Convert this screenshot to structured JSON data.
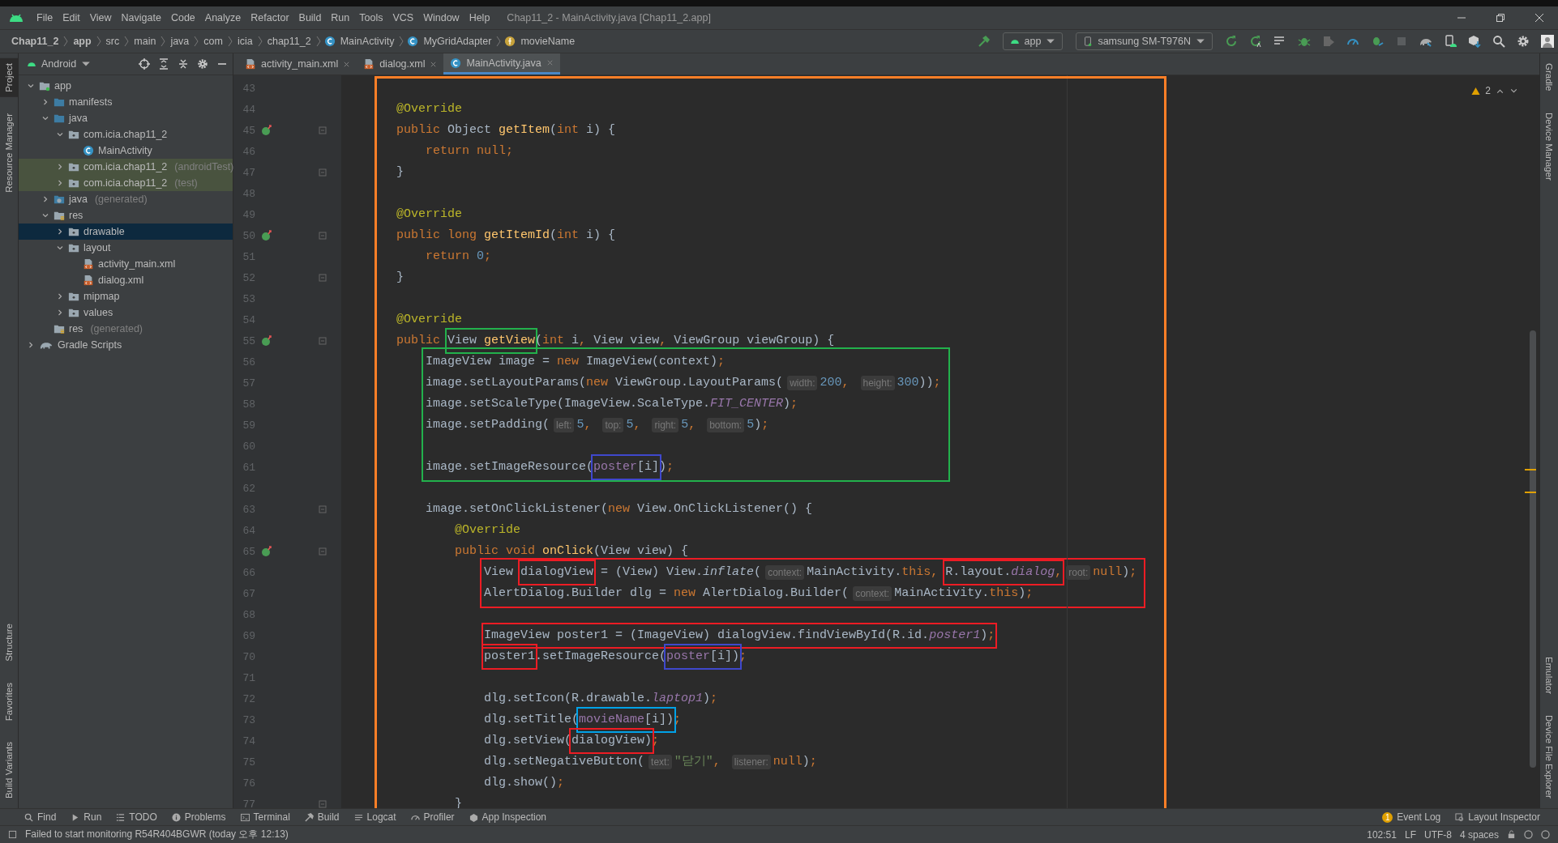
{
  "window": {
    "title": "Chap11_2 - MainActivity.java [Chap11_2.app]"
  },
  "menu": [
    "File",
    "Edit",
    "View",
    "Navigate",
    "Code",
    "Analyze",
    "Refactor",
    "Build",
    "Run",
    "Tools",
    "VCS",
    "Window",
    "Help"
  ],
  "breadcrumbs": [
    {
      "label": "Chap11_2",
      "kind": "plain"
    },
    {
      "label": "app",
      "kind": "plain"
    },
    {
      "label": "src",
      "kind": "plain"
    },
    {
      "label": "main",
      "kind": "plain"
    },
    {
      "label": "java",
      "kind": "plain"
    },
    {
      "label": "com",
      "kind": "plain"
    },
    {
      "label": "icia",
      "kind": "plain"
    },
    {
      "label": "chap11_2",
      "kind": "plain"
    },
    {
      "label": "MainActivity",
      "kind": "class"
    },
    {
      "label": "MyGridAdapter",
      "kind": "class"
    },
    {
      "label": "movieName",
      "kind": "field"
    }
  ],
  "run_config": "app",
  "device": "samsung SM-T976N",
  "project": {
    "view": "Android",
    "tree": [
      {
        "label": "app",
        "kind": "module",
        "expanded": true,
        "selected": false,
        "tinted": false,
        "children": [
          {
            "label": "manifests",
            "kind": "source",
            "expanded": false,
            "selected": false,
            "tinted": false
          },
          {
            "label": "java",
            "kind": "source",
            "expanded": true,
            "selected": false,
            "tinted": false,
            "children": [
              {
                "label": "com.icia.chap11_2",
                "kind": "package",
                "expanded": true,
                "selected": false,
                "tinted": false,
                "children": [
                  {
                    "label": "MainActivity",
                    "kind": "class",
                    "selected": false,
                    "tinted": false
                  }
                ]
              },
              {
                "label": "com.icia.chap11_2",
                "suffix": "(androidTest)",
                "kind": "package",
                "expanded": false,
                "selected": false,
                "tinted": true
              },
              {
                "label": "com.icia.chap11_2",
                "suffix": "(test)",
                "kind": "package",
                "expanded": false,
                "selected": false,
                "tinted": true
              }
            ]
          },
          {
            "label": "java",
            "suffix": "(generated)",
            "kind": "generated",
            "expanded": false,
            "selected": false,
            "tinted": false
          },
          {
            "label": "res",
            "kind": "res",
            "expanded": true,
            "selected": false,
            "tinted": false,
            "children": [
              {
                "label": "drawable",
                "kind": "package",
                "expanded": false,
                "selected": true,
                "tinted": false
              },
              {
                "label": "layout",
                "kind": "package",
                "expanded": true,
                "selected": false,
                "tinted": false,
                "children": [
                  {
                    "label": "activity_main.xml",
                    "kind": "xml",
                    "selected": false,
                    "tinted": false
                  },
                  {
                    "label": "dialog.xml",
                    "kind": "xml",
                    "selected": false,
                    "tinted": false
                  }
                ]
              },
              {
                "label": "mipmap",
                "kind": "package",
                "expanded": false,
                "selected": false,
                "tinted": false
              },
              {
                "label": "values",
                "kind": "package",
                "expanded": false,
                "selected": false,
                "tinted": false
              }
            ]
          },
          {
            "label": "res",
            "suffix": "(generated)",
            "kind": "res",
            "selected": false,
            "tinted": false
          }
        ]
      },
      {
        "label": "Gradle Scripts",
        "kind": "gradle",
        "expanded": false,
        "selected": false,
        "tinted": false
      }
    ]
  },
  "tabs": [
    {
      "label": "activity_main.xml",
      "kind": "xml",
      "selected": false
    },
    {
      "label": "dialog.xml",
      "kind": "xml",
      "selected": false
    },
    {
      "label": "MainActivity.java",
      "kind": "class",
      "selected": true
    }
  ],
  "left_stripe": {
    "top": [
      {
        "label": "Project",
        "selected": true
      },
      {
        "label": "Resource Manager",
        "selected": false
      }
    ],
    "bottom": [
      {
        "label": "Structure",
        "selected": false
      },
      {
        "label": "Favorites",
        "selected": false
      },
      {
        "label": "Build Variants",
        "selected": false
      }
    ]
  },
  "right_stripe": {
    "top": [
      "Gradle",
      "Device Manager"
    ],
    "bottom": [
      "Emulator",
      "Device File Explorer"
    ]
  },
  "editor": {
    "warnings": "2",
    "frame": {
      "color": "#ff7f27"
    },
    "blocks": [
      {
        "lines": [
          {
            "n": "43"
          },
          {
            "n": "44",
            "tokens": [
              {
                "t": "@Override",
                "kind": "annotation"
              }
            ]
          },
          {
            "n": "45",
            "overrides": true,
            "fold": true,
            "tokens": [
              {
                "t": "public ",
                "kind": "keyword"
              },
              {
                "t": "Object ",
                "kind": "plain"
              },
              {
                "t": "getItem",
                "kind": "method"
              },
              {
                "t": "(",
                "kind": "plain"
              },
              {
                "t": "int",
                "kind": "keyword"
              },
              {
                "t": " i) {",
                "kind": "plain"
              }
            ]
          },
          {
            "n": "46",
            "tokens": [
              {
                "t": "return null",
                "kind": "keyword"
              },
              {
                "t": ";",
                "kind": "keyword"
              }
            ]
          },
          {
            "n": "47",
            "fold": true,
            "tokens": [
              {
                "t": "}",
                "kind": "plain"
              }
            ]
          },
          {
            "n": "48"
          },
          {
            "n": "49",
            "tokens": [
              {
                "t": "@Override",
                "kind": "annotation"
              }
            ]
          },
          {
            "n": "50",
            "overrides": true,
            "fold": true,
            "tokens": [
              {
                "t": "public long ",
                "kind": "keyword"
              },
              {
                "t": "getItemId",
                "kind": "method"
              },
              {
                "t": "(",
                "kind": "plain"
              },
              {
                "t": "int",
                "kind": "keyword"
              },
              {
                "t": " i) {",
                "kind": "plain"
              }
            ]
          },
          {
            "n": "51",
            "tokens": [
              {
                "t": "return ",
                "kind": "keyword"
              },
              {
                "t": "0",
                "kind": "number"
              },
              {
                "t": ";",
                "kind": "keyword"
              }
            ]
          },
          {
            "n": "52",
            "fold": true,
            "tokens": [
              {
                "t": "}",
                "kind": "plain"
              }
            ]
          },
          {
            "n": "53"
          },
          {
            "n": "54",
            "tokens": [
              {
                "t": "@Override",
                "kind": "annotation"
              }
            ]
          },
          {
            "n": "55",
            "overrides": true,
            "fold": true,
            "tokens": [
              {
                "t": "public ",
                "kind": "keyword"
              },
              {
                "color": "#22b14c",
                "tokens": [
                  {
                    "t": "View ",
                    "kind": "plain"
                  },
                  {
                    "t": "getView",
                    "kind": "method"
                  }
                ]
              },
              {
                "t": "(",
                "kind": "plain"
              },
              {
                "t": "int ",
                "kind": "keyword"
              },
              {
                "t": "i",
                "kind": "plain"
              },
              {
                "t": ",",
                "kind": "keyword"
              },
              {
                "t": " View view",
                "kind": "plain"
              },
              {
                "t": ",",
                "kind": "keyword"
              },
              {
                "t": " ViewGroup viewGroup) {",
                "kind": "plain"
              }
            ]
          }
        ]
      },
      {
        "color": "#22b14c",
        "lines": [
          {
            "n": "56",
            "tokens": [
              {
                "t": "ImageView image = ",
                "kind": "plain"
              },
              {
                "t": "new ",
                "kind": "keyword"
              },
              {
                "t": "ImageView(context)",
                "kind": "plain"
              },
              {
                "t": ";",
                "kind": "keyword"
              }
            ]
          },
          {
            "n": "57",
            "tokens": [
              {
                "t": "image.setLayoutParams(",
                "kind": "plain"
              },
              {
                "t": "new ",
                "kind": "keyword"
              },
              {
                "t": "ViewGroup.LayoutParams(",
                "kind": "plain"
              },
              {
                "t": "width:",
                "kind": "hint"
              },
              {
                "t": "200",
                "kind": "number"
              },
              {
                "t": ", ",
                "kind": "keyword"
              },
              {
                "t": "height:",
                "kind": "hint"
              },
              {
                "t": "300",
                "kind": "number"
              },
              {
                "t": "))",
                "kind": "plain"
              },
              {
                "t": ";",
                "kind": "keyword"
              }
            ]
          },
          {
            "n": "58",
            "tokens": [
              {
                "t": "image.setScaleType(ImageView.ScaleType.",
                "kind": "plain"
              },
              {
                "t": "FIT_CENTER",
                "kind": "constant"
              },
              {
                "t": ")",
                "kind": "plain"
              },
              {
                "t": ";",
                "kind": "keyword"
              }
            ]
          },
          {
            "n": "59",
            "tokens": [
              {
                "t": "image.setPadding(",
                "kind": "plain"
              },
              {
                "t": "left:",
                "kind": "hint"
              },
              {
                "t": "5",
                "kind": "number"
              },
              {
                "t": ", ",
                "kind": "keyword"
              },
              {
                "t": "top:",
                "kind": "hint"
              },
              {
                "t": "5",
                "kind": "number"
              },
              {
                "t": ", ",
                "kind": "keyword"
              },
              {
                "t": "right:",
                "kind": "hint"
              },
              {
                "t": "5",
                "kind": "number"
              },
              {
                "t": ", ",
                "kind": "keyword"
              },
              {
                "t": "bottom:",
                "kind": "hint"
              },
              {
                "t": "5",
                "kind": "number"
              },
              {
                "t": ")",
                "kind": "plain"
              },
              {
                "t": ";",
                "kind": "keyword"
              }
            ]
          },
          {
            "n": "60"
          },
          {
            "n": "61",
            "tokens": [
              {
                "t": "image.setImageResource(",
                "kind": "plain"
              },
              {
                "color": "#3f48cc",
                "tokens": [
                  {
                    "t": "poster",
                    "kind": "field"
                  },
                  {
                    "t": "[i]",
                    "kind": "plain"
                  }
                ]
              },
              {
                "t": ")",
                "kind": "plain"
              },
              {
                "t": ";",
                "kind": "keyword"
              }
            ]
          }
        ]
      },
      {
        "lines": [
          {
            "n": "62"
          },
          {
            "n": "63",
            "fold": true,
            "tokens": [
              {
                "t": "image.setOnClickListener(",
                "kind": "plain"
              },
              {
                "t": "new ",
                "kind": "keyword"
              },
              {
                "t": "View.OnClickListener() {",
                "kind": "plain"
              }
            ]
          },
          {
            "n": "64",
            "tokens": [
              {
                "t": "@Override",
                "kind": "annotation"
              }
            ]
          },
          {
            "n": "65",
            "overrides": true,
            "fold": true,
            "tokens": [
              {
                "t": "public void ",
                "kind": "keyword"
              },
              {
                "t": "onClick",
                "kind": "method"
              },
              {
                "t": "(View view) {",
                "kind": "plain"
              }
            ]
          }
        ]
      },
      {
        "color": "#ed1c24",
        "lines": [
          {
            "n": "66",
            "tokens": [
              {
                "t": "View ",
                "kind": "plain"
              },
              {
                "color": "#ed1c24",
                "tokens": [
                  {
                    "t": "dialogView",
                    "kind": "plain"
                  }
                ]
              },
              {
                "t": " = (View) View.",
                "kind": "plain"
              },
              {
                "t": "inflate",
                "kind": "italic"
              },
              {
                "t": "(",
                "kind": "plain"
              },
              {
                "t": "context:",
                "kind": "hint"
              },
              {
                "t": "MainActivity.",
                "kind": "plain"
              },
              {
                "t": "this",
                "kind": "keyword"
              },
              {
                "t": ", ",
                "kind": "keyword"
              },
              {
                "color": "#ed1c24",
                "tokens": [
                  {
                    "t": "R.layout.",
                    "kind": "plain"
                  },
                  {
                    "t": "dialog",
                    "kind": "constant"
                  },
                  {
                    "t": ",",
                    "kind": "keyword"
                  }
                ]
              },
              {
                "t": "root:",
                "kind": "hint"
              },
              {
                "t": "null",
                "kind": "keyword"
              },
              {
                "t": ")",
                "kind": "plain"
              },
              {
                "t": ";",
                "kind": "keyword"
              }
            ]
          },
          {
            "n": "67",
            "tokens": [
              {
                "t": "AlertDialog.Builder dlg = ",
                "kind": "plain"
              },
              {
                "t": "new ",
                "kind": "keyword"
              },
              {
                "t": "AlertDialog.Builder(",
                "kind": "plain"
              },
              {
                "t": "context:",
                "kind": "hint"
              },
              {
                "t": "MainActivity.",
                "kind": "plain"
              },
              {
                "t": "this",
                "kind": "keyword"
              },
              {
                "t": ")",
                "kind": "plain"
              },
              {
                "t": ";",
                "kind": "keyword"
              }
            ]
          }
        ]
      },
      {
        "lines": [
          {
            "n": "68"
          },
          {
            "n": "69",
            "tokens": [
              {
                "color": "#ed1c24",
                "tokens": [
                  {
                    "t": "ImageView poster1 = (ImageView) dialogView.findViewById(R.id.",
                    "kind": "plain"
                  },
                  {
                    "t": "poster1",
                    "kind": "constant"
                  },
                  {
                    "t": ")",
                    "kind": "plain"
                  },
                  {
                    "t": ";",
                    "kind": "keyword"
                  }
                ]
              }
            ]
          },
          {
            "n": "70",
            "tokens": [
              {
                "color": "#ed1c24",
                "tokens": [
                  {
                    "t": "poster1",
                    "kind": "plain"
                  }
                ]
              },
              {
                "t": ".setImageResource(",
                "kind": "plain"
              },
              {
                "color": "#3f48cc",
                "tokens": [
                  {
                    "t": "poster",
                    "kind": "field"
                  },
                  {
                    "t": "[i])",
                    "kind": "plain"
                  }
                ]
              },
              {
                "t": ";",
                "kind": "keyword"
              }
            ]
          },
          {
            "n": "71"
          },
          {
            "n": "72",
            "tokens": [
              {
                "t": "dlg.setIcon(R.drawable.",
                "kind": "plain"
              },
              {
                "t": "laptop1",
                "kind": "constant"
              },
              {
                "t": ")",
                "kind": "plain"
              },
              {
                "t": ";",
                "kind": "keyword"
              }
            ]
          },
          {
            "n": "73",
            "tokens": [
              {
                "t": "dlg.setTitle(",
                "kind": "plain"
              },
              {
                "color": "#00a2e8",
                "tokens": [
                  {
                    "t": "movieName",
                    "kind": "field"
                  },
                  {
                    "t": "[i])",
                    "kind": "plain"
                  }
                ]
              },
              {
                "t": ";",
                "kind": "keyword"
              }
            ]
          },
          {
            "n": "74",
            "tokens": [
              {
                "t": "dlg.setView(",
                "kind": "plain"
              },
              {
                "color": "#ed1c24",
                "tokens": [
                  {
                    "t": "dialogView)",
                    "kind": "plain"
                  }
                ]
              },
              {
                "t": ";",
                "kind": "keyword"
              }
            ]
          },
          {
            "n": "75",
            "tokens": [
              {
                "t": "dlg.setNegativeButton(",
                "kind": "plain"
              },
              {
                "t": "text:",
                "kind": "hint"
              },
              {
                "t": "\"닫기\"",
                "kind": "string"
              },
              {
                "t": ", ",
                "kind": "keyword"
              },
              {
                "t": "listener:",
                "kind": "hint"
              },
              {
                "t": "null",
                "kind": "keyword"
              },
              {
                "t": ")",
                "kind": "plain"
              },
              {
                "t": ";",
                "kind": "keyword"
              }
            ]
          },
          {
            "n": "76",
            "tokens": [
              {
                "t": "dlg.show()",
                "kind": "plain"
              },
              {
                "t": ";",
                "kind": "keyword"
              }
            ]
          },
          {
            "n": "77",
            "fold": true,
            "tokens": [
              {
                "t": "}",
                "kind": "plain"
              }
            ]
          }
        ]
      }
    ]
  },
  "tool_windows": [
    {
      "label": "Find",
      "kind": "search"
    },
    {
      "label": "Run",
      "kind": "run"
    },
    {
      "label": "TODO",
      "kind": "list"
    },
    {
      "label": "Problems",
      "kind": "problems"
    },
    {
      "label": "Terminal",
      "kind": "terminal"
    },
    {
      "label": "Build",
      "kind": "build"
    },
    {
      "label": "Logcat",
      "kind": "logcat"
    },
    {
      "label": "Profiler",
      "kind": "profiler"
    },
    {
      "label": "App Inspection",
      "kind": "inspection"
    }
  ],
  "tool_windows_right": [
    {
      "label": "Event Log",
      "badge": "1"
    },
    {
      "label": "Layout Inspector"
    }
  ],
  "status_bar": {
    "message": "Failed to start monitoring R54R404BGWR (today 오후 12:13)",
    "items": [
      "102:51",
      "LF",
      "UTF-8",
      "4 spaces"
    ]
  }
}
